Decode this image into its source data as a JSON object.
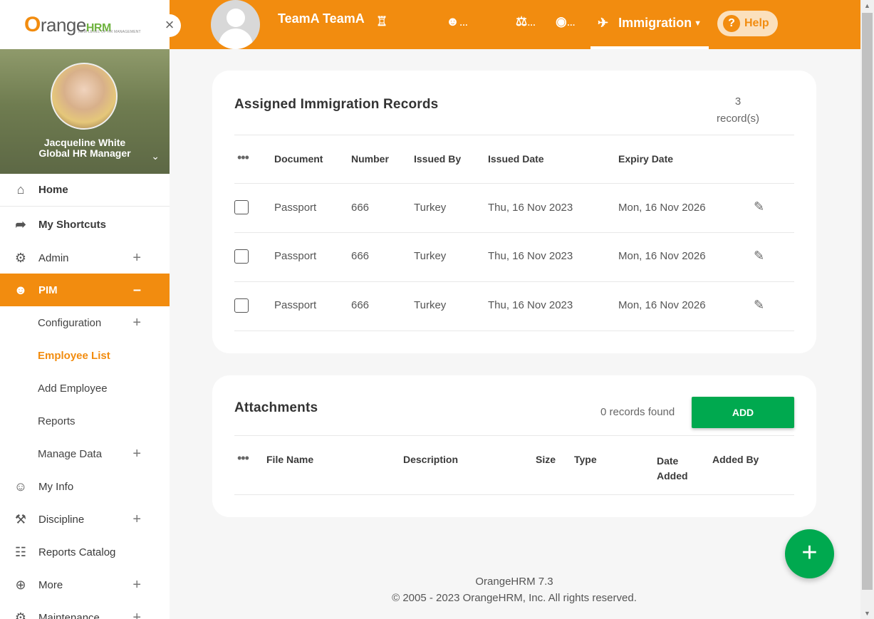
{
  "brand": {
    "logo_o": "O",
    "logo_main": "range",
    "logo_hrm": "HRM",
    "logo_tagline": "NEW LEVEL OF HR MANAGEMENT"
  },
  "sidebar": {
    "close": "×",
    "user_name": "Jacqueline White",
    "user_title": "Global HR Manager",
    "menu": {
      "home": "Home",
      "shortcuts": "My Shortcuts",
      "admin": "Admin",
      "pim": "PIM",
      "configuration": "Configuration",
      "employee_list": "Employee List",
      "add_employee": "Add Employee",
      "reports": "Reports",
      "manage_data": "Manage Data",
      "my_info": "My Info",
      "discipline": "Discipline",
      "reports_catalog": "Reports Catalog",
      "more": "More",
      "maintenance": "Maintenance"
    }
  },
  "topbar": {
    "employee_name": "TeamA TeamA",
    "tab_active_label": "Immigration",
    "tab_more_1": "…",
    "tab_more_2": "…",
    "tab_more_3": "…",
    "help_label": "Help"
  },
  "immigration": {
    "title": "Assigned Immigration Records",
    "count": "3",
    "count_label": "record(s)",
    "columns": [
      "Document",
      "Number",
      "Issued By",
      "Issued Date",
      "Expiry Date"
    ],
    "rows": [
      {
        "document": "Passport",
        "number": "666",
        "issued_by": "Turkey",
        "issued_date": "Thu, 16 Nov 2023",
        "expiry_date": "Mon, 16 Nov 2026"
      },
      {
        "document": "Passport",
        "number": "666",
        "issued_by": "Turkey",
        "issued_date": "Thu, 16 Nov 2023",
        "expiry_date": "Mon, 16 Nov 2026"
      },
      {
        "document": "Passport",
        "number": "666",
        "issued_by": "Turkey",
        "issued_date": "Thu, 16 Nov 2023",
        "expiry_date": "Mon, 16 Nov 2026"
      }
    ]
  },
  "attachments": {
    "title": "Attachments",
    "found": "0 records found",
    "add_label": "ADD",
    "columns": {
      "file_name": "File Name",
      "description": "Description",
      "size": "Size",
      "type": "Type",
      "date_added_1": "Date",
      "date_added_2": "Added",
      "added_by": "Added By"
    }
  },
  "footer": {
    "version": "OrangeHRM 7.3",
    "copyright_prefix": "© 2005 - 2023 ",
    "company": "OrangeHRM, Inc",
    "copyright_suffix": ". All rights reserved."
  },
  "colors": {
    "brand_orange": "#f28c0f",
    "add_green": "#00a94f",
    "logo_green": "#6fb33f"
  }
}
